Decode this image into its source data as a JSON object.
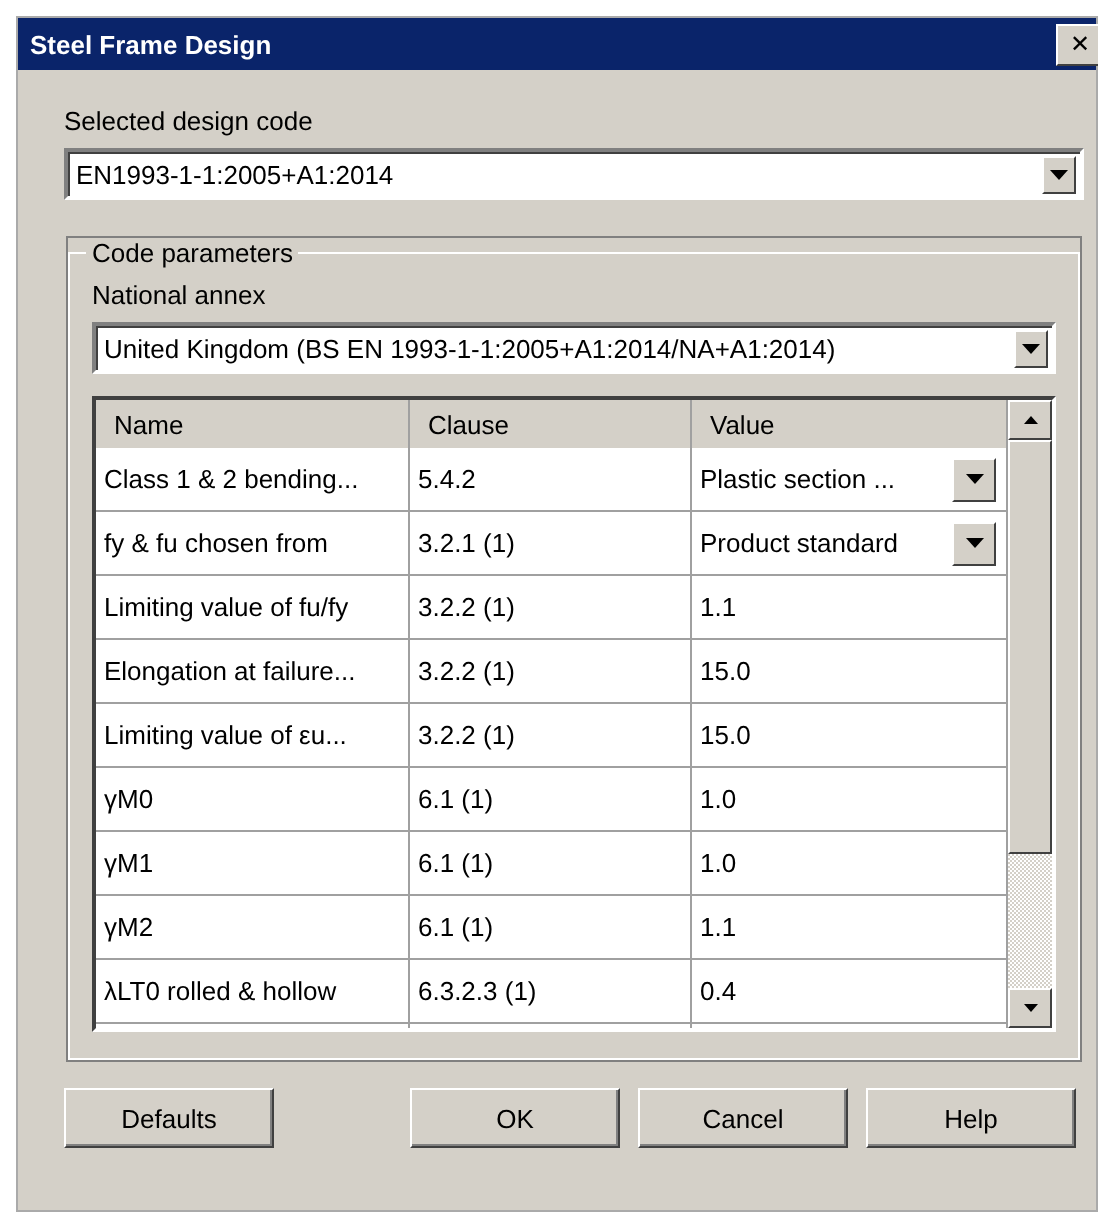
{
  "window": {
    "title": "Steel Frame Design",
    "close": "✕"
  },
  "design_code": {
    "label": "Selected design code",
    "value": "EN1993-1-1:2005+A1:2014"
  },
  "code_parameters": {
    "title": "Code parameters",
    "national_annex": {
      "label": "National annex",
      "value": "United Kingdom (BS EN 1993-1-1:2005+A1:2014/NA+A1:2014)"
    },
    "table": {
      "columns": [
        "Name",
        "Clause",
        "Value"
      ],
      "rows": [
        {
          "name": "Class 1 & 2 bending...",
          "clause": "5.4.2",
          "value": "Plastic section ...",
          "kind": "dropdown"
        },
        {
          "name": "fy & fu chosen from",
          "clause": "3.2.1 (1)",
          "value": "Product standard",
          "kind": "dropdown"
        },
        {
          "name": "Limiting value of fu/fy",
          "clause": "3.2.2 (1)",
          "value": "1.1",
          "kind": "text"
        },
        {
          "name": "Elongation at failure...",
          "clause": "3.2.2 (1)",
          "value": "15.0",
          "kind": "text"
        },
        {
          "name": "Limiting value of εu...",
          "clause": "3.2.2 (1)",
          "value": "15.0",
          "kind": "text"
        },
        {
          "name": "γM0",
          "clause": "6.1 (1)",
          "value": "1.0",
          "kind": "text"
        },
        {
          "name": "γM1",
          "clause": "6.1 (1)",
          "value": "1.0",
          "kind": "text"
        },
        {
          "name": "γM2",
          "clause": "6.1 (1)",
          "value": "1.1",
          "kind": "text"
        },
        {
          "name": "λLT0 rolled & hollow",
          "clause": "6.3.2.3 (1)",
          "value": "0.4",
          "kind": "text"
        }
      ]
    }
  },
  "buttons": [
    "Defaults",
    "OK",
    "Cancel",
    "Help"
  ]
}
